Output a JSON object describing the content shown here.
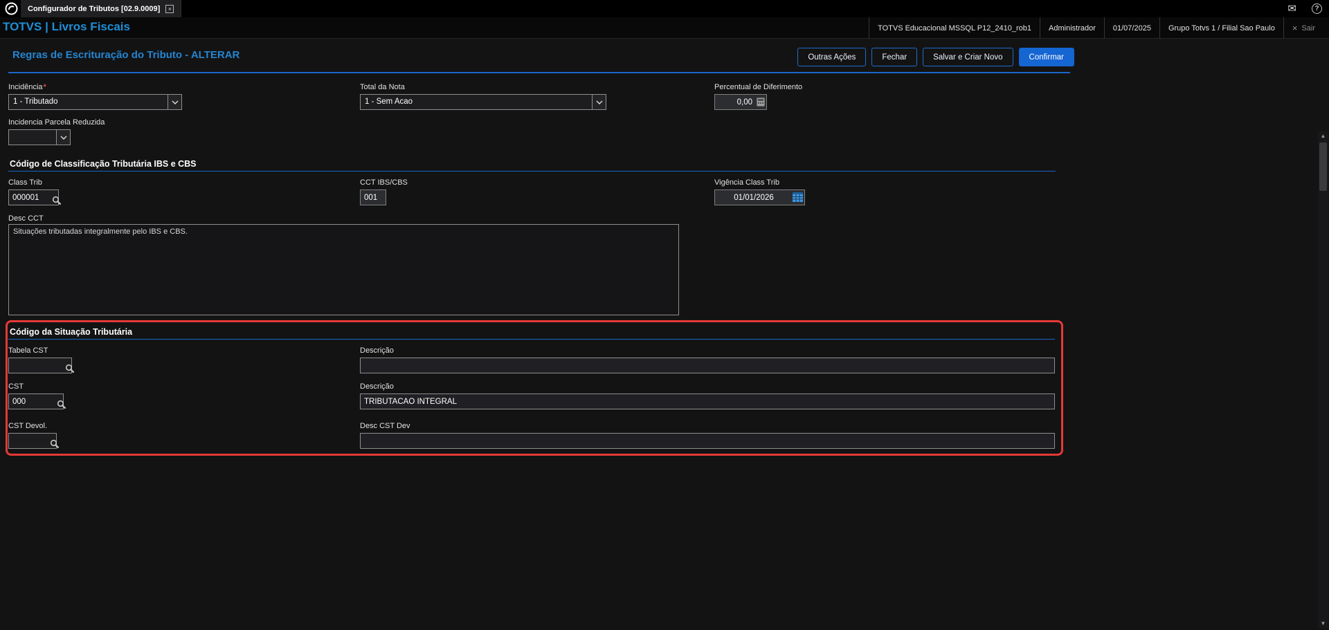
{
  "topbar": {
    "tab_title": "Configurador de Tributos [02.9.0009]",
    "tab_close": "×"
  },
  "header": {
    "brand": "TOTVS | Livros Fiscais",
    "environment": "TOTVS Educacional MSSQL P12_2410_rob1",
    "user": "Administrador",
    "date": "01/07/2025",
    "company": "Grupo Totvs 1 / Filial Sao Paulo",
    "exit_label": "Sair",
    "exit_icon": "×"
  },
  "page": {
    "title": "Regras de Escrituração do Tributo - ALTERAR"
  },
  "toolbar": {
    "outras_acoes": "Outras Ações",
    "fechar": "Fechar",
    "salvar_criar_novo": "Salvar e Criar Novo",
    "confirmar": "Confirmar"
  },
  "form": {
    "incidencia": {
      "label": "Incidência",
      "required_mark": "*",
      "value": "1 - Tributado"
    },
    "total_nota": {
      "label": "Total da Nota",
      "value": "1 - Sem Acao"
    },
    "perc_diferimento": {
      "label": "Percentual de Diferimento",
      "value": "0,00"
    },
    "inc_parcela_reduzida": {
      "label": "Incidencia Parcela Reduzida",
      "value": ""
    }
  },
  "secao_class_trib": {
    "title": "Código de Classificação Tributária IBS e CBS",
    "class_trib": {
      "label": "Class Trib",
      "value": "000001"
    },
    "cct_ibs_cbs": {
      "label": "CCT IBS/CBS",
      "value": "001"
    },
    "vigencia": {
      "label": "Vigência Class Trib",
      "value": "01/01/2026"
    },
    "desc_cct": {
      "label": "Desc CCT",
      "value": "Situações tributadas integralmente pelo IBS e CBS."
    }
  },
  "secao_cst": {
    "title": "Código da Situação Tributária",
    "tabela_cst": {
      "label": "Tabela CST",
      "value": ""
    },
    "tabela_desc": {
      "label": "Descrição",
      "value": ""
    },
    "cst": {
      "label": "CST",
      "value": "000"
    },
    "cst_desc": {
      "label": "Descrição",
      "value": "TRIBUTACAO INTEGRAL"
    },
    "cst_devol": {
      "label": "CST Devol.",
      "value": ""
    },
    "desc_cst_dev": {
      "label": "Desc CST Dev",
      "value": ""
    }
  },
  "colors": {
    "accent_blue": "#1d6fc8",
    "title_blue": "#2585d0",
    "brand_blue": "#1f8fd6",
    "highlight_red": "#e53935",
    "required_red": "#e04b3c"
  }
}
